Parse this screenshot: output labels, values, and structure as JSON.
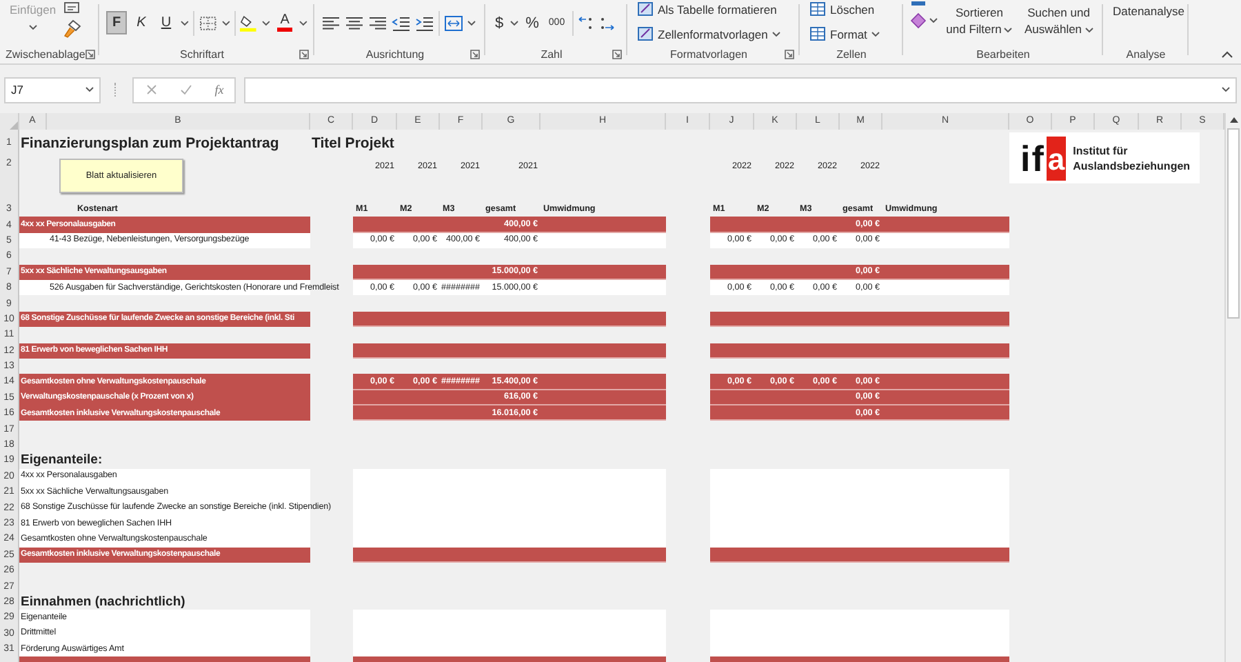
{
  "ribbon": {
    "clipboard": {
      "paste": "Einfügen",
      "label": "Zwischenablage"
    },
    "font": {
      "label": "Schriftart",
      "toggles": [
        {
          "text": "F",
          "kind": "bold",
          "selected": true
        },
        {
          "text": "K",
          "kind": "italic",
          "selected": false
        },
        {
          "text": "U",
          "kind": "underline",
          "selected": false
        }
      ],
      "font_color": "A"
    },
    "alignment": {
      "label": "Ausrichtung"
    },
    "number": {
      "label": "Zahl",
      "currency": "$",
      "percent": "%",
      "thousands": "000"
    },
    "styles": {
      "label": "Formatvorlagen",
      "items": [
        "Als Tabelle formatieren",
        "Zellenformatvorlagen"
      ]
    },
    "cells": {
      "label": "Zellen",
      "items": [
        "Löschen",
        "Format"
      ]
    },
    "editing": {
      "label": "Bearbeiten",
      "items": [
        "Sortieren und Filtern",
        "Suchen und Auswählen"
      ]
    },
    "analysis": {
      "label": "Analyse",
      "item": "Datenanalyse"
    }
  },
  "formula_bar": {
    "name_box": "J7",
    "fx": "fx"
  },
  "columns": [
    "A",
    "B",
    "C",
    "D",
    "E",
    "F",
    "G",
    "H",
    "I",
    "J",
    "K",
    "L",
    "M",
    "N",
    "O",
    "P",
    "Q",
    "R",
    "S"
  ],
  "button": "Blatt aktualisieren",
  "logo": {
    "mark": "if",
    "accent": "a",
    "name": "Institut für Auslandsbeziehungen"
  },
  "rows": [
    {
      "num": "1",
      "kind": "title",
      "label": "Finanzierungsplan zum Projektantrag",
      "title_2": "Titel Projekt"
    },
    {
      "num": "2",
      "kind": "years",
      "y2021": {
        "m1": "2021",
        "m2": "2021",
        "m3": "2021",
        "gesamt": "2021"
      },
      "y2022": {
        "m1": "2022",
        "m2": "2022",
        "m3": "2022",
        "gesamt": "2022"
      }
    },
    {
      "num": "3",
      "kind": "header",
      "label": "Kostenart",
      "y2021": {
        "m1": "M1",
        "m2": "M2",
        "m3": "M3",
        "gesamt": "gesamt",
        "umwidmung": "Umwidmung"
      },
      "y2022": {
        "m1": "M1",
        "m2": "M2",
        "m3": "M3",
        "gesamt": "gesamt",
        "umwidmung": "Umwidmung"
      }
    },
    {
      "num": "4",
      "kind": "band",
      "label": "4xx xx Personalausgaben",
      "y2021": {
        "gesamt": "400,00 €"
      },
      "y2022": {
        "gesamt": "0,00 €"
      }
    },
    {
      "num": "5",
      "kind": "entry",
      "indented": true,
      "label": "41-43 Bezüge, Nebenleistungen, Versorgungsbezüge",
      "y2021": {
        "m1": "0,00 €",
        "m2": "0,00 €",
        "m3": "400,00 €",
        "gesamt": "400,00 €"
      },
      "y2022": {
        "m1": "0,00 €",
        "m2": "0,00 €",
        "m3": "0,00 €",
        "gesamt": "0,00 €"
      }
    },
    {
      "num": "6",
      "kind": "blank"
    },
    {
      "num": "7",
      "kind": "band",
      "label": "5xx xx Sächliche Verwaltungsausgaben",
      "y2021": {
        "gesamt": "15.000,00 €"
      },
      "y2022": {
        "gesamt": "0,00 €"
      }
    },
    {
      "num": "8",
      "kind": "entry",
      "indented": true,
      "label": "526 Ausgaben für Sachverständige, Gerichtskosten (Honorare und Fremdleist",
      "y2021": {
        "m1": "0,00 €",
        "m2": "0,00 €",
        "m3": "########",
        "gesamt": "15.000,00 €"
      },
      "y2022": {
        "m1": "0,00 €",
        "m2": "0,00 €",
        "m3": "0,00 €",
        "gesamt": "0,00 €"
      }
    },
    {
      "num": "9",
      "kind": "blank"
    },
    {
      "num": "10",
      "kind": "band",
      "label": "68 Sonstige Zuschüsse für laufende Zwecke an sonstige Bereiche (inkl. Sti"
    },
    {
      "num": "11",
      "kind": "blank"
    },
    {
      "num": "12",
      "kind": "band",
      "label": "81 Erwerb von beweglichen Sachen IHH"
    },
    {
      "num": "13",
      "kind": "blank"
    },
    {
      "num": "14",
      "kind": "band",
      "label": "Gesamtkosten ohne Verwaltungskostenpauschale",
      "y2021": {
        "m1": "0,00 €",
        "m2": "0,00 €",
        "m3": "########",
        "gesamt": "15.400,00 €"
      },
      "y2022": {
        "m1": "0,00 €",
        "m2": "0,00 €",
        "m3": "0,00 €",
        "gesamt": "0,00 €"
      }
    },
    {
      "num": "15",
      "kind": "band",
      "label": "Verwaltungskostenpauschale (x Prozent von x)",
      "y2021": {
        "gesamt": "616,00 €"
      },
      "y2022": {
        "gesamt": "0,00 €"
      }
    },
    {
      "num": "16",
      "kind": "band",
      "label": "Gesamtkosten inklusive Verwaltungskostenpauschale",
      "y2021": {
        "gesamt": "16.016,00 €"
      },
      "y2022": {
        "gesamt": "0,00 €"
      }
    },
    {
      "num": "17",
      "kind": "blank"
    },
    {
      "num": "18",
      "kind": "blank"
    },
    {
      "num": "19",
      "kind": "heading",
      "label": "Eigenanteile:"
    },
    {
      "num": "20",
      "kind": "entry",
      "indented": false,
      "label": "4xx xx Personalausgaben"
    },
    {
      "num": "21",
      "kind": "entry",
      "indented": false,
      "label": "5xx xx Sächliche Verwaltungsausgaben"
    },
    {
      "num": "22",
      "kind": "entry",
      "indented": false,
      "label": "68 Sonstige Zuschüsse für laufende Zwecke an sonstige Bereiche (inkl. Stipendien)"
    },
    {
      "num": "23",
      "kind": "entry",
      "indented": false,
      "label": "81 Erwerb von beweglichen Sachen IHH"
    },
    {
      "num": "24",
      "kind": "entry",
      "indented": false,
      "label": "Gesamtkosten ohne Verwaltungskostenpauschale"
    },
    {
      "num": "25",
      "kind": "band",
      "label": "Gesamtkosten inklusive Verwaltungskostenpauschale"
    },
    {
      "num": "26",
      "kind": "blank"
    },
    {
      "num": "27",
      "kind": "blank"
    },
    {
      "num": "28",
      "kind": "heading",
      "label": "Einnahmen (nachrichtlich)"
    },
    {
      "num": "29",
      "kind": "entry",
      "indented": false,
      "label": "Eigenanteile"
    },
    {
      "num": "30",
      "kind": "entry",
      "indented": false,
      "label": "Drittmittel"
    },
    {
      "num": "31",
      "kind": "entry",
      "indented": false,
      "label": "Förderung Auswärtiges Amt"
    },
    {
      "kind": "band"
    }
  ]
}
